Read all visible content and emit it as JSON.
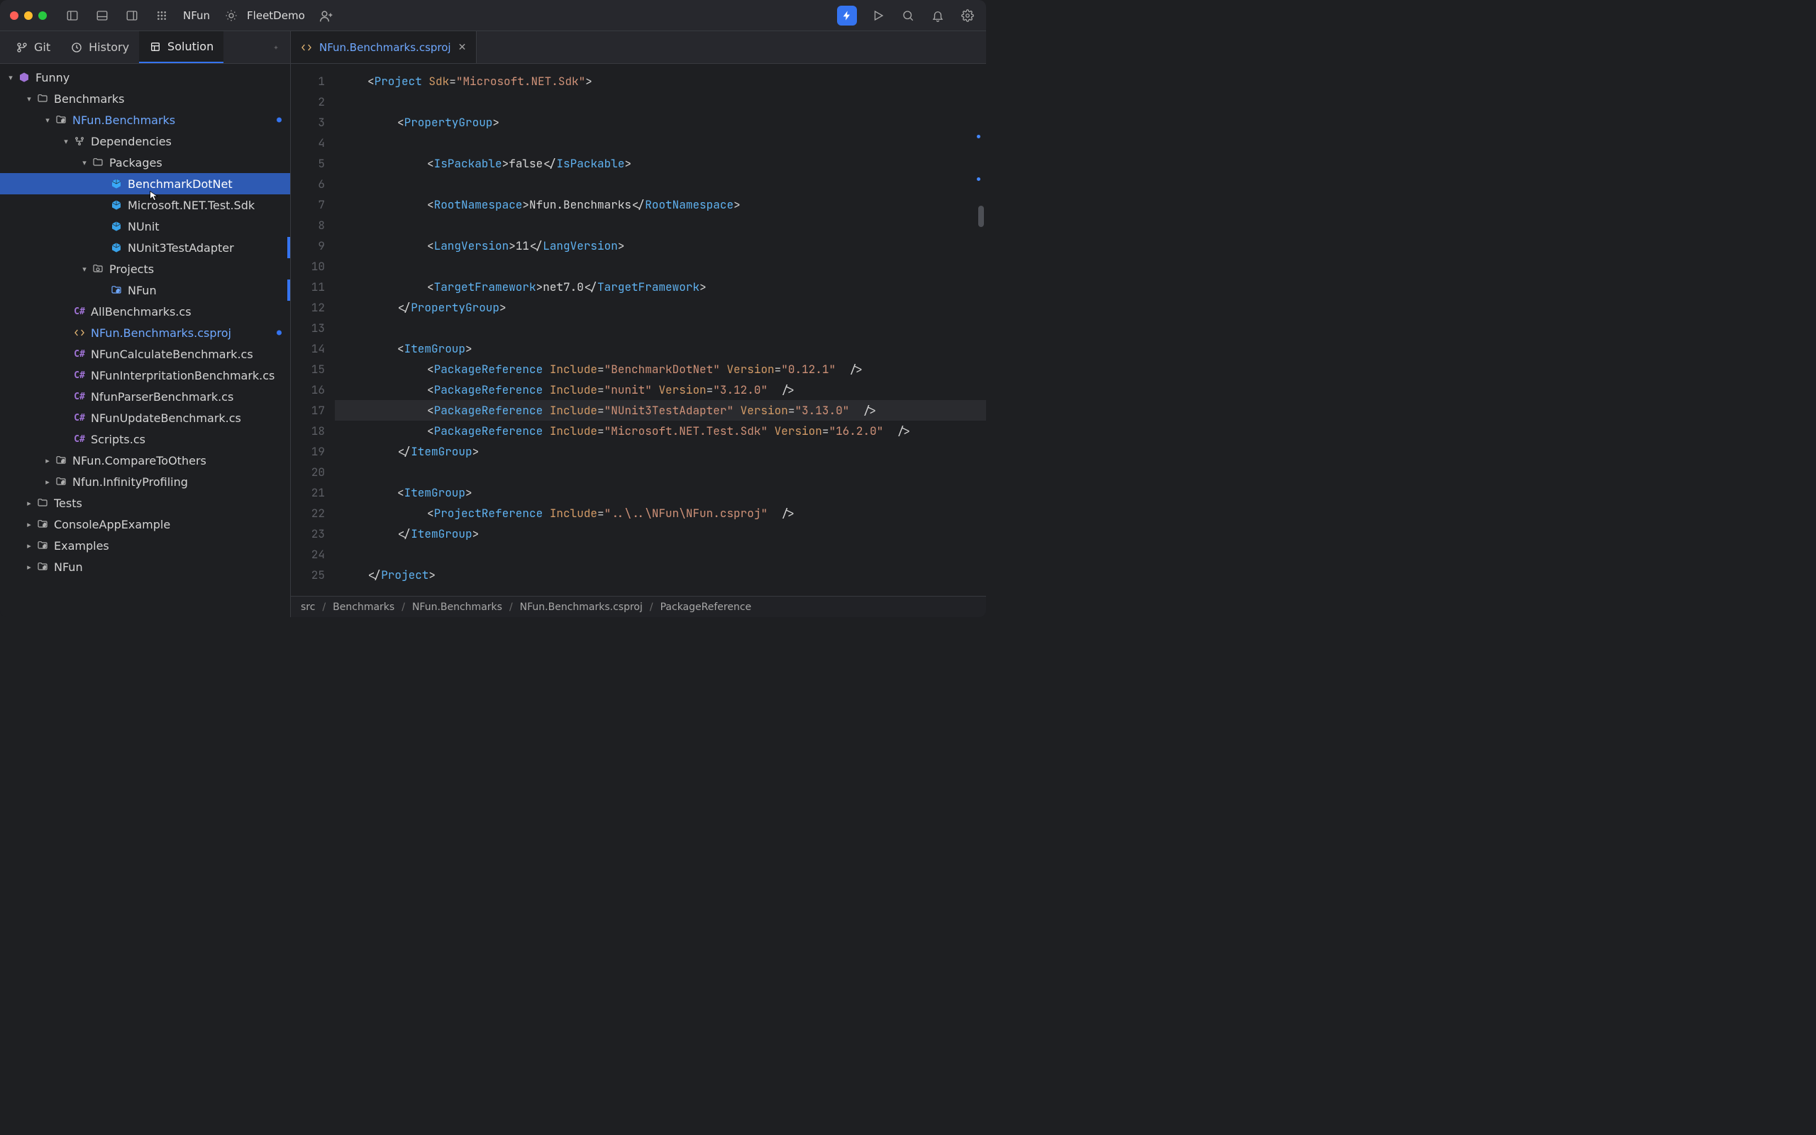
{
  "toolbar": {
    "project": "NFun",
    "run_config": "FleetDemo"
  },
  "side_tabs": {
    "git": "Git",
    "history": "History",
    "solution": "Solution"
  },
  "tree": {
    "root": "Funny",
    "benchmarks": "Benchmarks",
    "nfun_benchmarks": "NFun.Benchmarks",
    "dependencies": "Dependencies",
    "packages": "Packages",
    "pkg_bdn": "BenchmarkDotNet",
    "pkg_mstest": "Microsoft.NET.Test.Sdk",
    "pkg_nunit": "NUnit",
    "pkg_nunit3": "NUnit3TestAdapter",
    "projects": "Projects",
    "proj_nfun": "NFun",
    "file_all": "AllBenchmarks.cs",
    "file_csproj": "NFun.Benchmarks.csproj",
    "file_calc": "NFunCalculateBenchmark.cs",
    "file_interp": "NFunInterpritationBenchmark.cs",
    "file_parser": "NfunParserBenchmark.cs",
    "file_update": "NFunUpdateBenchmark.cs",
    "file_scripts": "Scripts.cs",
    "folder_compare": "NFun.CompareToOthers",
    "folder_infinity": "Nfun.InfinityProfiling",
    "folder_tests": "Tests",
    "folder_console": "ConsoleAppExample",
    "folder_examples": "Examples",
    "folder_nfun": "NFun"
  },
  "editor": {
    "tab_filename": "NFun.Benchmarks.csproj",
    "lines": [
      "<Project Sdk=\"Microsoft.NET.Sdk\">",
      "",
      "    <PropertyGroup>",
      "",
      "        <IsPackable>false</IsPackable>",
      "",
      "        <RootNamespace>Nfun.Benchmarks</RootNamespace>",
      "",
      "        <LangVersion>11</LangVersion>",
      "",
      "        <TargetFramework>net7.0</TargetFramework>",
      "    </PropertyGroup>",
      "",
      "    <ItemGroup>",
      "        <PackageReference Include=\"BenchmarkDotNet\" Version=\"0.12.1\" />",
      "        <PackageReference Include=\"nunit\" Version=\"3.12.0\" />",
      "        <PackageReference Include=\"NUnit3TestAdapter\" Version=\"3.13.0\" />",
      "        <PackageReference Include=\"Microsoft.NET.Test.Sdk\" Version=\"16.2.0\" />",
      "    </ItemGroup>",
      "",
      "    <ItemGroup>",
      "        <ProjectReference Include=\"..\\..\\NFun\\NFun.csproj\" />",
      "    </ItemGroup>",
      "",
      "</Project>"
    ],
    "current_line_index": 16
  },
  "breadcrumb": [
    "src",
    "Benchmarks",
    "NFun.Benchmarks",
    "NFun.Benchmarks.csproj",
    "PackageReference"
  ]
}
